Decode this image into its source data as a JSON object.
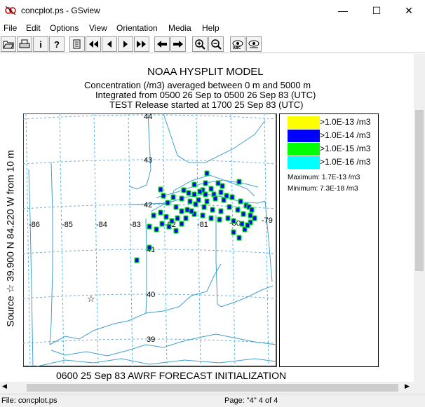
{
  "window": {
    "title": "concplot.ps - GSview",
    "controls": [
      "—",
      "☐",
      "✕"
    ]
  },
  "menu": [
    "File",
    "Edit",
    "Options",
    "View",
    "Orientation",
    "Media",
    "Help"
  ],
  "toolbar": {
    "buttons": [
      "open-icon",
      "print-icon",
      "info-icon",
      "help-icon",
      "goto-page-icon",
      "first-page-icon",
      "prev-page-icon",
      "next-page-icon",
      "last-page-icon",
      "back-icon",
      "forward-icon",
      "zoom-in-icon",
      "zoom-out-icon",
      "full-screen-icon",
      "text-extract-icon"
    ],
    "info_glyph": "i",
    "help_glyph": "?"
  },
  "plot": {
    "title": "NOAA HYSPLIT MODEL",
    "line1": "Concentration  (/m3) averaged between      0 m and  5000  m",
    "line2": "Integrated from 0500 26 Sep to 0500 26 Sep 83 (UTC)",
    "line3": "TEST Release started at 1700 25 Sep 83 (UTC)",
    "source_label": "Source ☆  39.900  N  84.220  W      from  10 m",
    "footer": "0600 25 Sep 83 AWRF FORECAST INITIALIZATION",
    "lon_labels": [
      "-86",
      "-85",
      "-84",
      "-83",
      "-82",
      "-81",
      "-80",
      "-79"
    ],
    "lat_labels": [
      "44",
      "43",
      "42",
      "41",
      "40",
      "39"
    ],
    "source_marker": "☆",
    "legend": [
      {
        "label": ">1.0E-13 /m3",
        "color": "#ffff00"
      },
      {
        "label": ">1.0E-14 /m3",
        "color": "#0000ff"
      },
      {
        "label": ">1.0E-15 /m3",
        "color": "#00ff00"
      },
      {
        "label": ">1.0E-16 /m3",
        "color": "#00ffff"
      }
    ],
    "maximum": "Maximum: 1.7E-13 /m3",
    "minimum": "Minimum: 7.3E-18 /m3"
  },
  "status": {
    "file": "File: concplot.ps",
    "page": "Page: \"4\"  4 of 4"
  },
  "colors": {
    "map_lines": "#40a0d0",
    "grid": "#60b0e0",
    "cell_fill": "#0000ff",
    "cell_edge": "#00ff00"
  }
}
